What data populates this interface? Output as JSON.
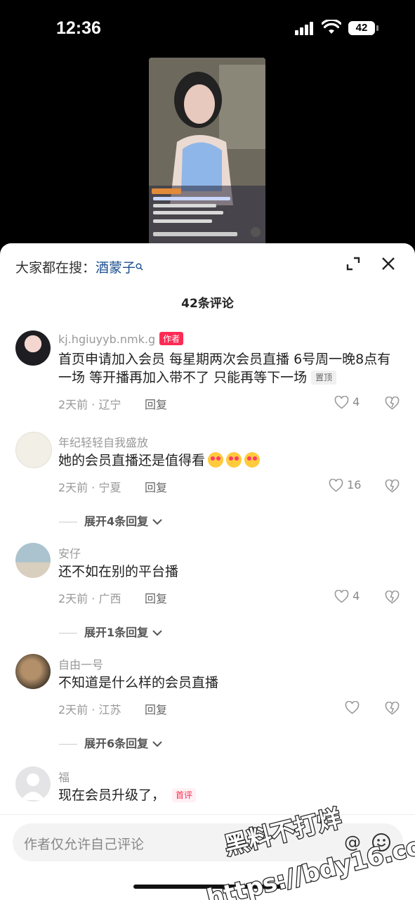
{
  "status_bar": {
    "time": "12:36",
    "battery": "42"
  },
  "search": {
    "prefix": "大家都在搜：",
    "keyword": "酒蒙子"
  },
  "comments_count_title": "42条评论",
  "comments": [
    {
      "user": "kj.hgiuyyb.nmk.g",
      "author_badge": "作者",
      "text": "首页申请加入会员 每星期两次会员直播 6号周一晚8点有一场 等开播再加入带不了 只能再等下一场",
      "pin_badge": "置顶",
      "meta": "2天前 · 辽宁",
      "reply": "回复",
      "likes": "4"
    },
    {
      "user": "年纪轻轻自我盛放",
      "text": "她的会员直播还是值得看",
      "meta": "2天前 · 宁夏",
      "reply": "回复",
      "likes": "16",
      "expand": "展开4条回复"
    },
    {
      "user": "安仔",
      "text": "还不如在别的平台播",
      "meta": "2天前 · 广西",
      "reply": "回复",
      "likes": "4",
      "expand": "展开1条回复"
    },
    {
      "user": "自由一号",
      "text": "不知道是什么样的会员直播",
      "meta": "2天前 · 江苏",
      "reply": "回复",
      "likes": "",
      "expand": "展开6条回复"
    },
    {
      "user": "福",
      "text": "现在会员升级了，",
      "first_badge": "首评"
    }
  ],
  "input": {
    "placeholder": "作者仅允许自己评论",
    "at_symbol": "@"
  },
  "watermark": {
    "line1": "黑料不打烊",
    "line2": "https://bdy16.co"
  },
  "colors": {
    "accent": "#fe2c55",
    "keyword": "#1a4f8f"
  }
}
